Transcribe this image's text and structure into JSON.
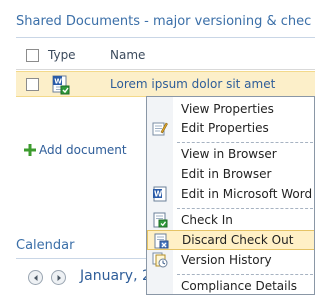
{
  "webpart": {
    "title": "Shared Documents - major versioning & chec"
  },
  "list": {
    "columns": {
      "type": "Type",
      "name": "Name"
    },
    "items": [
      {
        "name": "Lorem ipsum dolor sit amet",
        "icon": "word-doc-checked-out-icon"
      }
    ],
    "add_document_label": "Add document"
  },
  "calendar": {
    "title": "Calendar",
    "date_text": "January, 2"
  },
  "context_menu": {
    "items": [
      {
        "label": "View Properties",
        "icon": "none"
      },
      {
        "label": "Edit Properties",
        "icon": "edit-properties-icon"
      },
      {
        "label": "View in Browser",
        "icon": "none"
      },
      {
        "label": "Edit in Browser",
        "icon": "none"
      },
      {
        "label": "Edit in Microsoft Word",
        "icon": "word-icon"
      },
      {
        "label": "Check In",
        "icon": "check-in-icon"
      },
      {
        "label": "Discard Check Out",
        "icon": "discard-check-out-icon",
        "highlighted": true
      },
      {
        "label": "Version History",
        "icon": "version-history-icon"
      },
      {
        "label": "Compliance Details",
        "icon": "none"
      }
    ]
  },
  "colors": {
    "title_blue": "#3b6fa8",
    "link_blue": "#2e5d99",
    "row_highlight": "#fcefc9",
    "menu_highlight": "#fff0c6"
  }
}
